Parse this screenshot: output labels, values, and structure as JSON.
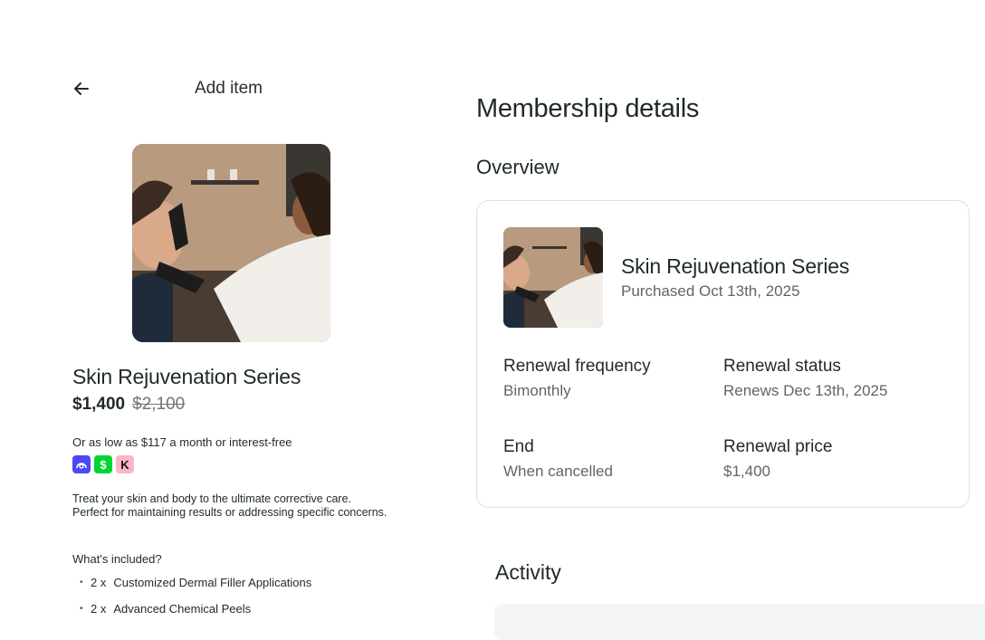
{
  "header": {
    "back_icon": "arrow-left-icon",
    "title": "Add item"
  },
  "product": {
    "name": "Skin Rejuvenation Series",
    "price": "$1,400",
    "original_price": "$2,100",
    "financing_text": "Or as low as $117 a month or interest-free",
    "payment_badges": [
      {
        "name": "affirm-icon",
        "glyph": "a",
        "color": "#4a4af4"
      },
      {
        "name": "cash-app-icon",
        "glyph": "$",
        "color": "#00d632"
      },
      {
        "name": "klarna-icon",
        "glyph": "K",
        "color": "#ffb3c7"
      }
    ],
    "description": "Treat your skin and body to the ultimate corrective care. Perfect for maintaining results or addressing specific concerns.",
    "included_label": "What's included?",
    "included": [
      {
        "qty": "2 x",
        "name": "Customized Dermal Filler Applications"
      },
      {
        "qty": "2 x",
        "name": "Advanced Chemical Peels"
      }
    ]
  },
  "membership": {
    "title": "Membership details",
    "overview_label": "Overview",
    "card": {
      "name": "Skin Rejuvenation Series",
      "purchased": "Purchased Oct 13th, 2025",
      "renewal_frequency_label": "Renewal frequency",
      "renewal_frequency": "Bimonthly",
      "renewal_status_label": "Renewal status",
      "renewal_status": "Renews Dec 13th, 2025",
      "end_label": "End",
      "end": "When cancelled",
      "renewal_price_label": "Renewal price",
      "renewal_price": "$1,400"
    },
    "activity_label": "Activity"
  }
}
